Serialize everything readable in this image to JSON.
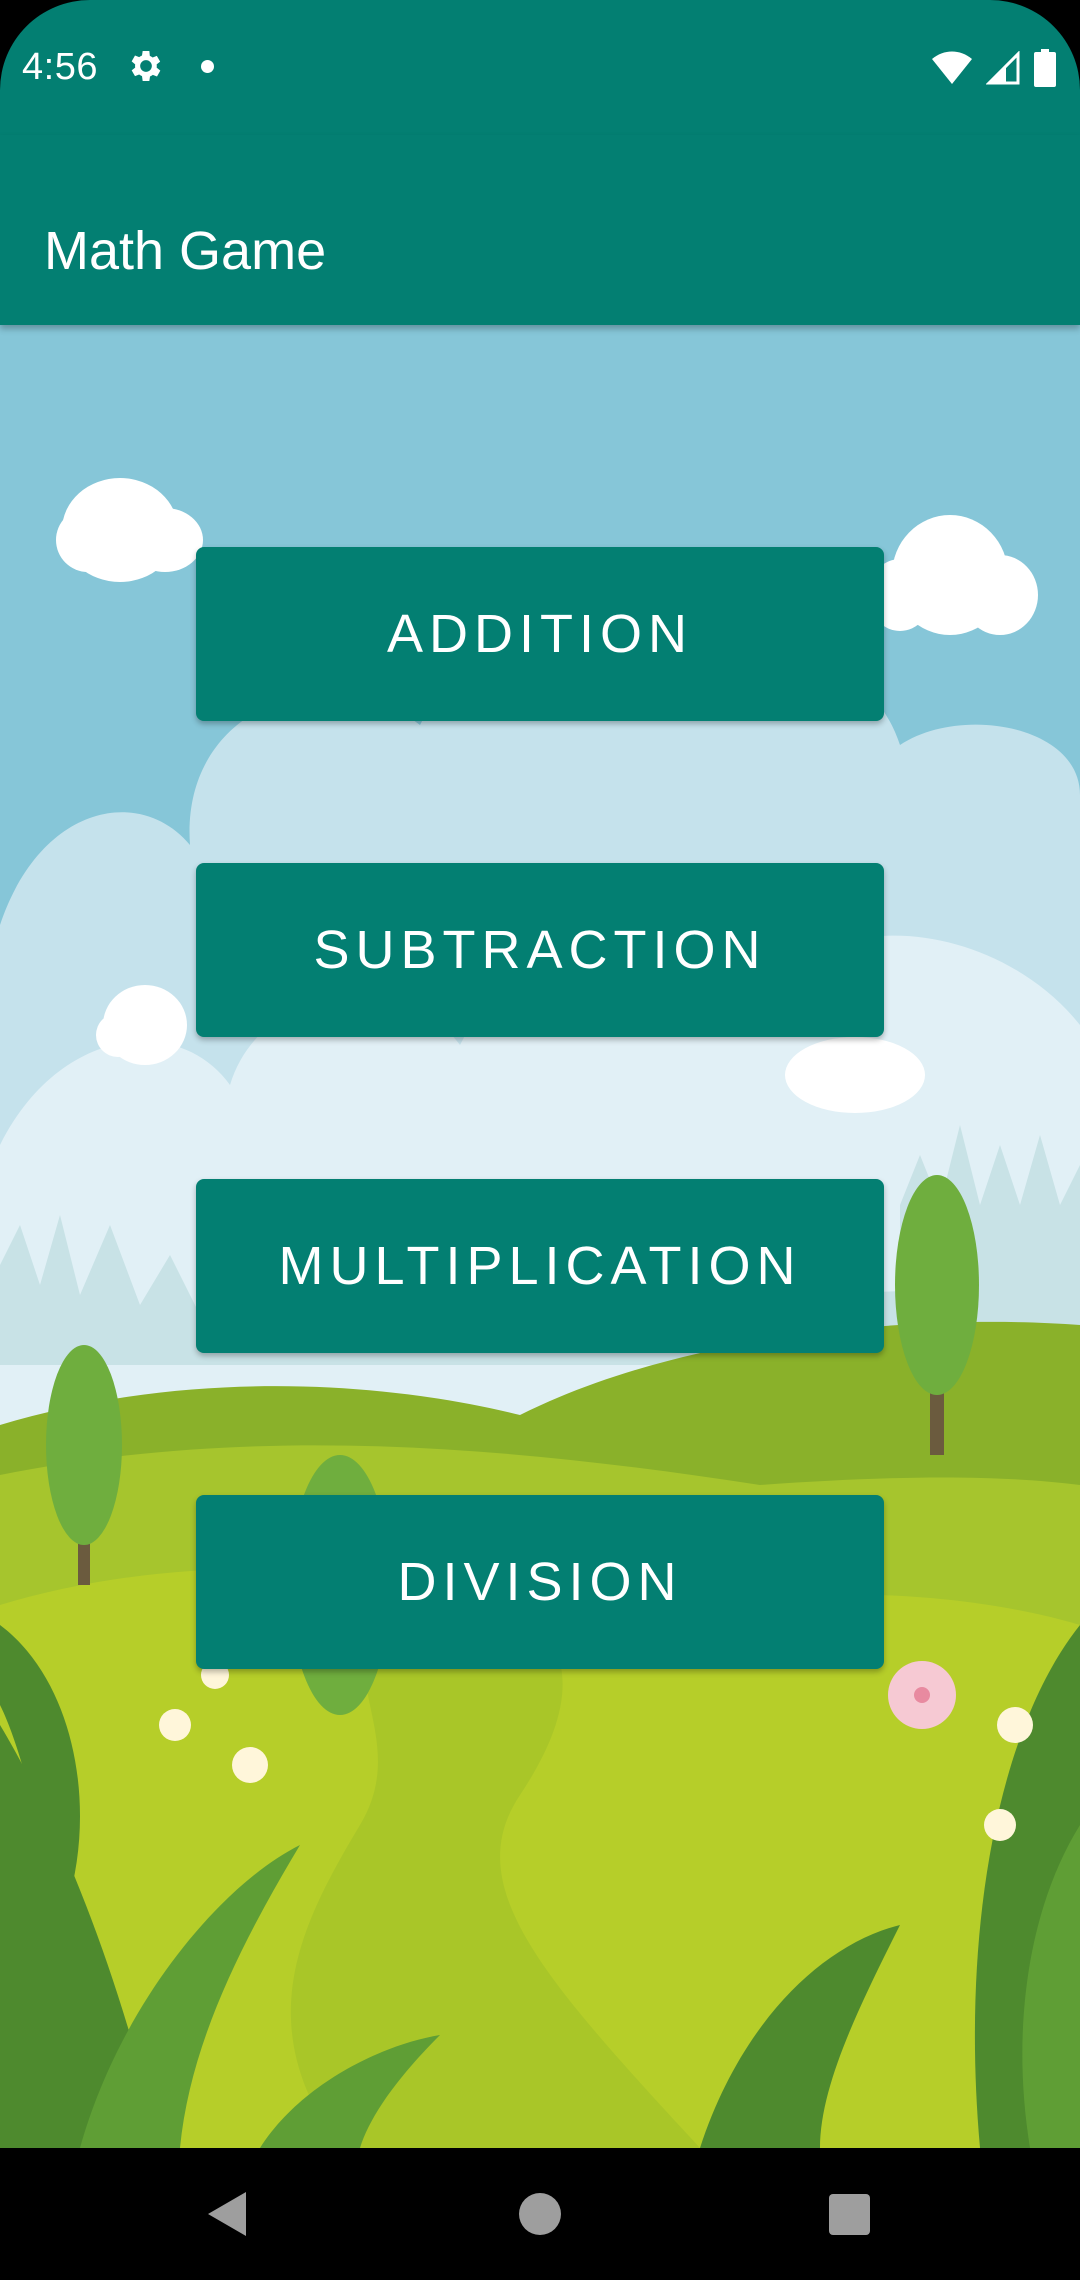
{
  "status_bar": {
    "time": "4:56",
    "icons": [
      "settings-gear-icon",
      "notification-dot-icon",
      "wifi-icon",
      "cell-signal-icon",
      "battery-icon"
    ]
  },
  "app_bar": {
    "title": "Math Game"
  },
  "menu": {
    "buttons": [
      {
        "label": "ADDITION"
      },
      {
        "label": "SUBTRACTION"
      },
      {
        "label": "MULTIPLICATION"
      },
      {
        "label": "DIVISION"
      }
    ]
  },
  "nav_bar": {
    "icons": [
      "back-icon",
      "home-icon",
      "recents-icon"
    ]
  },
  "colors": {
    "primary": "#037F72",
    "sky": "#86C6D8",
    "grass_light": "#B6CE29",
    "grass_dark": "#8AB12A",
    "button_text": "#FFFFFF"
  }
}
